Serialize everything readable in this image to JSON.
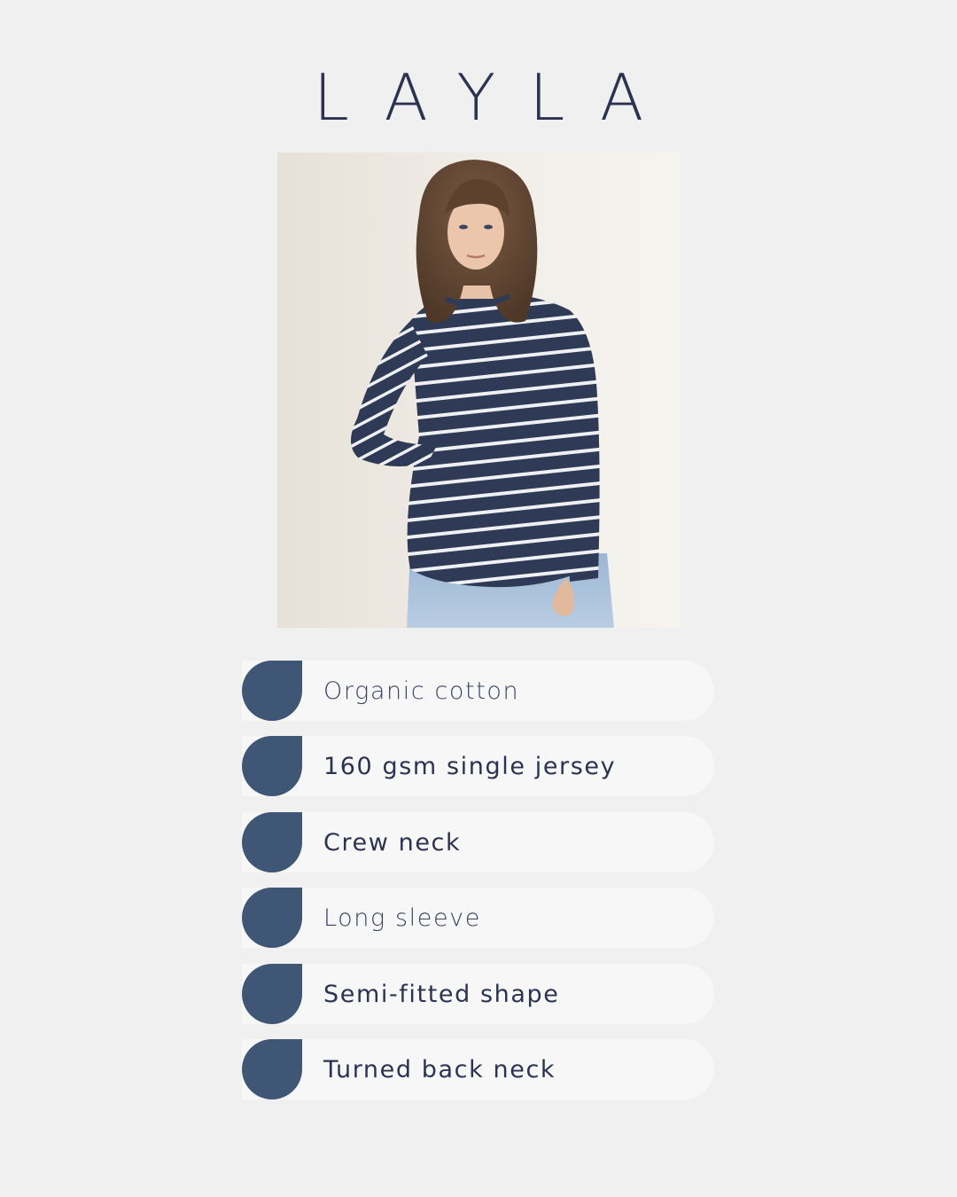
{
  "title": "LAYLA",
  "colors": {
    "background": "#f0f0f0",
    "title": "#2b3350",
    "accent": "#3f5675",
    "pill": "#f7f7f7",
    "stripe_navy": "#2f3a56"
  },
  "features": [
    {
      "label": "Organic cotton",
      "icon": "drop-icon"
    },
    {
      "label": "160 gsm single jersey",
      "icon": "drop-icon"
    },
    {
      "label": "Crew neck",
      "icon": "drop-icon"
    },
    {
      "label": "Long sleeve",
      "icon": "drop-icon"
    },
    {
      "label": "Semi-fitted shape",
      "icon": "drop-icon"
    },
    {
      "label": "Turned back neck",
      "icon": "drop-icon"
    }
  ]
}
